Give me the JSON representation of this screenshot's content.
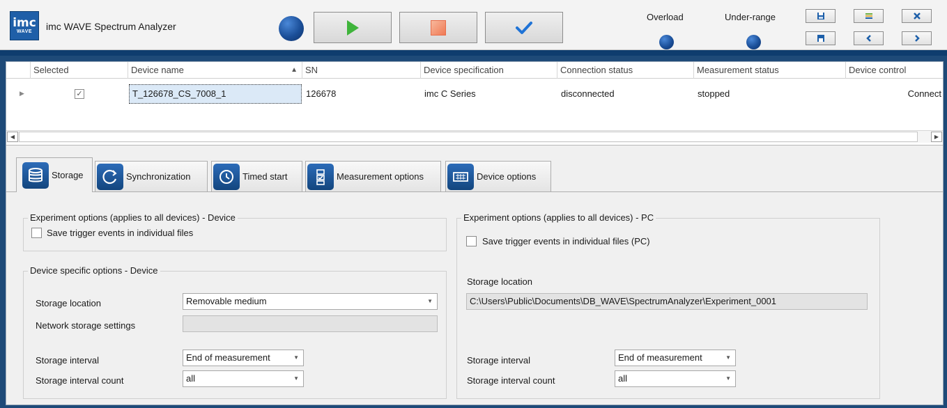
{
  "header": {
    "logo_line1": "imc",
    "logo_line2": "WAVE",
    "title": "imc WAVE Spectrum Analyzer",
    "overload_label": "Overload",
    "underrange_label": "Under-range"
  },
  "grid": {
    "columns": [
      "Selected",
      "Device name",
      "SN",
      "Device specification",
      "Connection status",
      "Measurement status",
      "Device control"
    ],
    "row": {
      "device_name": "T_126678_CS_7008_1",
      "sn": "126678",
      "spec": "imc C Series",
      "connection": "disconnected",
      "measurement": "stopped",
      "control": "Connect",
      "selected_mark": "✓"
    }
  },
  "tabs": [
    {
      "label": "Storage"
    },
    {
      "label": "Synchronization"
    },
    {
      "label": "Timed start"
    },
    {
      "label": "Measurement options"
    },
    {
      "label": "Device options"
    }
  ],
  "storage": {
    "device_group_title": "Experiment options (applies to all devices) - Device",
    "device_save_trigger": "Save trigger events in individual files",
    "specific_group_title": "Device specific options - Device",
    "storage_location_label": "Storage location",
    "storage_location_value": "Removable medium",
    "network_label": "Network storage settings",
    "interval_label": "Storage interval",
    "interval_value": "End of measurement",
    "count_label": "Storage interval count",
    "count_value": "all",
    "pc_group_title": "Experiment options (applies to all devices) - PC",
    "pc_save_trigger": "Save trigger events in individual files (PC)",
    "pc_location_label": "Storage location",
    "pc_location_value": "C:\\Users\\Public\\Documents\\DB_WAVE\\SpectrumAnalyzer\\Experiment_0001",
    "pc_interval_label": "Storage interval",
    "pc_interval_value": "End of measurement",
    "pc_count_label": "Storage interval count",
    "pc_count_value": "all"
  }
}
